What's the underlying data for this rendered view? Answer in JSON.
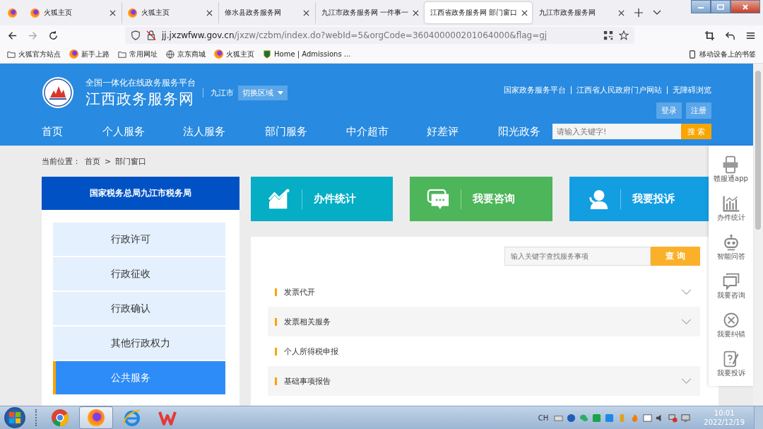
{
  "browser": {
    "tabs": [
      {
        "kind": "pinned",
        "selected": false
      },
      {
        "kind": "page",
        "title": "火狐主页",
        "favicon": true,
        "selected": false
      },
      {
        "kind": "page",
        "title": "火狐主页",
        "favicon": true,
        "selected": false
      },
      {
        "kind": "page",
        "title": "修水县政务服务网",
        "favicon": false,
        "selected": false
      },
      {
        "kind": "page",
        "title": "九江市政务服务网 一件事一",
        "favicon": false,
        "selected": false
      },
      {
        "kind": "page",
        "title": "江西省政务服务网 部门窗口",
        "favicon": false,
        "selected": true
      },
      {
        "kind": "page",
        "title": "九江市政务服务网",
        "favicon": false,
        "selected": false
      }
    ],
    "url_host": "jj.jxzwfww.gov.cn",
    "url_path": "/jxzw/czbm/index.do?webId=5&orgCode=360400000201064000&flag=gj",
    "bookmarks": [
      {
        "label": "火狐官方站点",
        "kind": "folder"
      },
      {
        "label": "新手上路",
        "kind": "firefox"
      },
      {
        "label": "常用网址",
        "kind": "folder"
      },
      {
        "label": "京东商城",
        "kind": "globe"
      },
      {
        "label": "火狐主页",
        "kind": "firefox"
      },
      {
        "label": "Home | Admissions ...",
        "kind": "crest"
      }
    ],
    "mobile_bookmarks": "移动设备上的书签"
  },
  "site": {
    "subtitle": "全国一体化在线政务服务平台",
    "title": "江西政务服务网",
    "city": "九江市",
    "region_button": "切换区域",
    "top_links": [
      "国家政务服务平台",
      "江西省人民政府门户网站",
      "无障碍浏览"
    ],
    "auth_buttons": [
      "登录",
      "注册"
    ],
    "nav": [
      "首页",
      "个人服务",
      "法人服务",
      "部门服务",
      "中介超市",
      "好差评",
      "阳光政务"
    ],
    "search_placeholder": "请输入关键字!",
    "search_button": "搜 索"
  },
  "breadcrumb": {
    "label": "当前位置：",
    "items": [
      "首页",
      "部门窗口"
    ],
    "separator": ">"
  },
  "department": {
    "title": "国家税务总局九江市税务局",
    "menu": [
      {
        "label": "行政许可",
        "selected": false
      },
      {
        "label": "行政征收",
        "selected": false
      },
      {
        "label": "行政确认",
        "selected": false
      },
      {
        "label": "其他行政权力",
        "selected": false
      },
      {
        "label": "公共服务",
        "selected": true
      }
    ]
  },
  "tiles": [
    {
      "label": "办件统计",
      "kind": "chart",
      "color": "#05aec5"
    },
    {
      "label": "我要咨询",
      "kind": "chat",
      "color": "#4db55a"
    },
    {
      "label": "我要投诉",
      "kind": "person",
      "color": "#139ee2"
    }
  ],
  "services": {
    "search_placeholder": "输入关键字查找服务事项",
    "search_button": "查 询",
    "items": [
      {
        "label": "发票代开",
        "expandable": true
      },
      {
        "label": "发票相关服务",
        "expandable": true
      },
      {
        "label": "个人所得税申报",
        "expandable": false
      },
      {
        "label": "基础事项报告",
        "expandable": true
      }
    ]
  },
  "float_bar": [
    {
      "label": "赣服通app",
      "kind": "app"
    },
    {
      "label": "办件统计",
      "kind": "chart"
    },
    {
      "label": "智能问答",
      "kind": "robot"
    },
    {
      "label": "我要咨询",
      "kind": "chat"
    },
    {
      "label": "我要纠错",
      "kind": "cross"
    },
    {
      "label": "我要投诉",
      "kind": "question"
    }
  ],
  "taskbar": {
    "apps": [
      {
        "kind": "chrome",
        "selected": false
      },
      {
        "kind": "firefox",
        "selected": true
      },
      {
        "kind": "ie",
        "selected": false
      },
      {
        "kind": "wps",
        "selected": false
      }
    ],
    "language": "CH",
    "time": "10:01",
    "date": "2022/12/19"
  }
}
